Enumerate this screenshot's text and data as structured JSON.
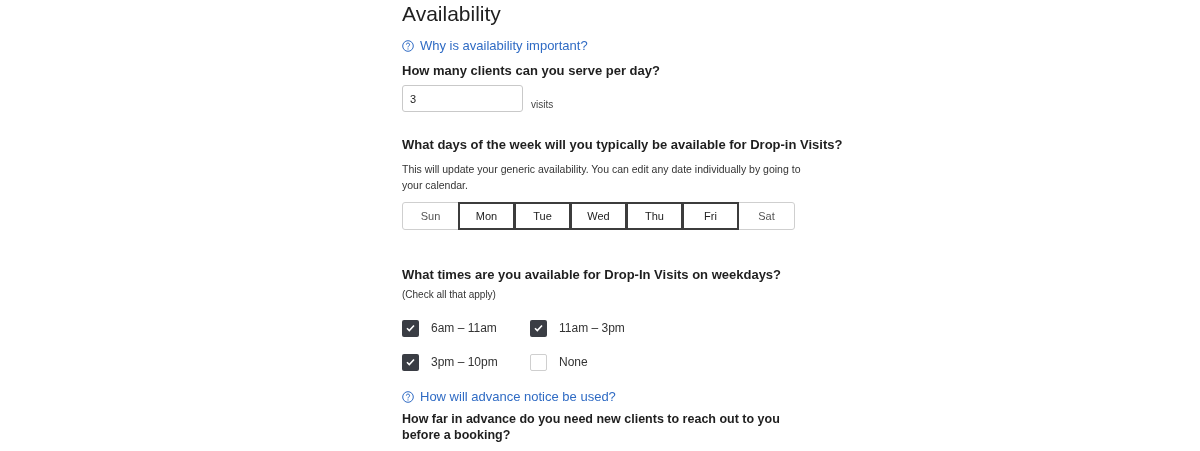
{
  "title": "Availability",
  "help_links": [
    "Why is availability important?",
    "How will advance notice be used?"
  ],
  "clients": {
    "question": "How many clients can you serve per day?",
    "value": "3",
    "unit": "visits"
  },
  "days": {
    "question": "What days of the week will you typically be available for Drop-in Visits?",
    "description": "This will update your generic availability. You can edit any date individually by going to your calendar.",
    "items": [
      {
        "label": "Sun",
        "selected": false
      },
      {
        "label": "Mon",
        "selected": true
      },
      {
        "label": "Tue",
        "selected": true
      },
      {
        "label": "Wed",
        "selected": true
      },
      {
        "label": "Thu",
        "selected": true
      },
      {
        "label": "Fri",
        "selected": true
      },
      {
        "label": "Sat",
        "selected": false
      }
    ]
  },
  "times": {
    "question": "What times are you available for Drop-In Visits on weekdays?",
    "hint": "(Check all that apply)",
    "options": [
      {
        "label": "6am – 11am",
        "checked": true
      },
      {
        "label": "11am – 3pm",
        "checked": true
      },
      {
        "label": "3pm – 10pm",
        "checked": true
      },
      {
        "label": "None",
        "checked": false
      }
    ]
  },
  "notice": {
    "question": "How far in advance do you need new clients to reach out to you before a booking?"
  }
}
